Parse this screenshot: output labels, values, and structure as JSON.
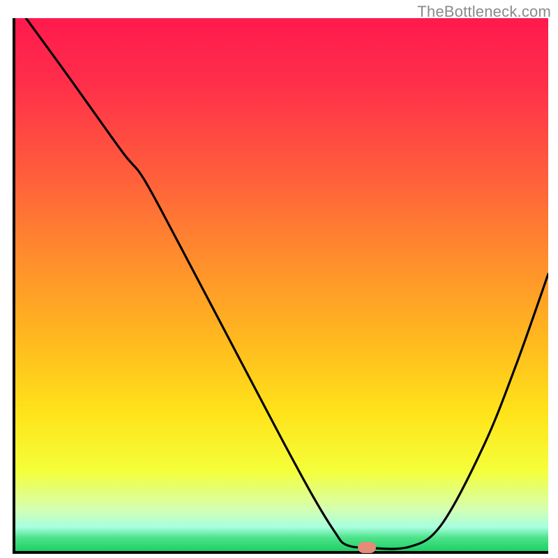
{
  "attribution": "TheBottleneck.com",
  "colors": {
    "gradient_stops": [
      {
        "offset": 0.0,
        "color": "#ff1a4d"
      },
      {
        "offset": 0.12,
        "color": "#ff2e4a"
      },
      {
        "offset": 0.28,
        "color": "#ff5a3d"
      },
      {
        "offset": 0.44,
        "color": "#ff8a2e"
      },
      {
        "offset": 0.6,
        "color": "#ffb81f"
      },
      {
        "offset": 0.74,
        "color": "#ffe31a"
      },
      {
        "offset": 0.85,
        "color": "#f4ff3a"
      },
      {
        "offset": 0.92,
        "color": "#d6ffb0"
      },
      {
        "offset": 0.955,
        "color": "#a8ffe0"
      },
      {
        "offset": 0.975,
        "color": "#4de38a"
      },
      {
        "offset": 1.0,
        "color": "#1ecf66"
      }
    ],
    "curve": "#000000",
    "marker": "#e68a7a"
  },
  "chart_data": {
    "type": "line",
    "title": "",
    "xlabel": "",
    "ylabel": "",
    "xlim": [
      0,
      100
    ],
    "ylim": [
      0,
      100
    ],
    "grid": false,
    "series": [
      {
        "name": "bottleneck-curve",
        "x": [
          2,
          10,
          20,
          24,
          30,
          40,
          50,
          56,
          60,
          62,
          66,
          74,
          80,
          88,
          94,
          100
        ],
        "y": [
          100,
          89,
          75,
          70,
          59,
          40,
          21,
          10,
          3.5,
          1.2,
          0.6,
          0.8,
          5,
          20,
          35,
          52
        ]
      }
    ],
    "marker": {
      "x": 66,
      "y": 0.6
    }
  }
}
